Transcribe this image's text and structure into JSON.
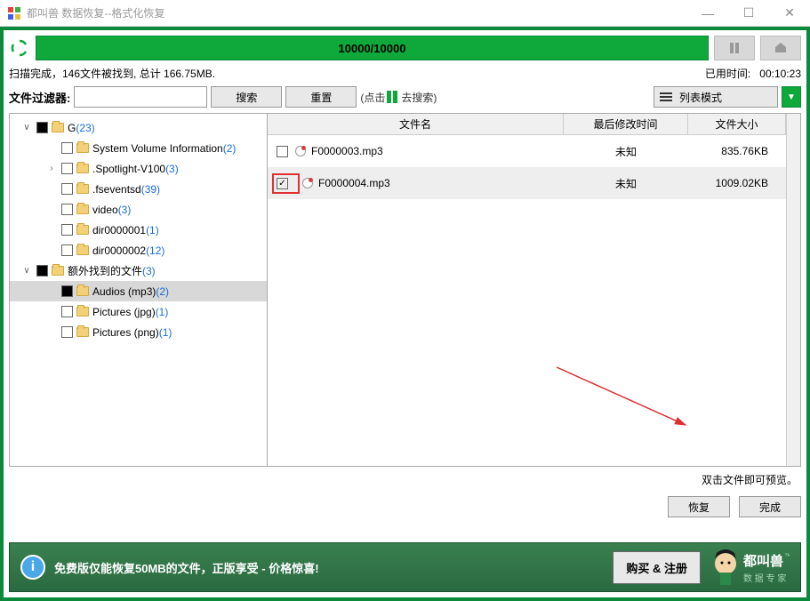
{
  "window": {
    "title": "都叫兽 数据恢复--格式化恢复"
  },
  "progress": {
    "text": "10000/10000"
  },
  "status": {
    "left": "扫描完成，146文件被找到, 总计 166.75MB.",
    "elapsed_label": "已用时间:",
    "elapsed_value": "00:10:23"
  },
  "filter": {
    "label": "文件过滤器:",
    "search_btn": "搜索",
    "reset_btn": "重置",
    "hint_prefix": "(点击",
    "hint_suffix": "去搜索)",
    "view_mode": "列表模式"
  },
  "tree": [
    {
      "indent": 0,
      "toggle": "∨",
      "check": "partial",
      "label": "G",
      "count": "(23)"
    },
    {
      "indent": 1,
      "toggle": "",
      "check": "empty",
      "label": "System Volume Information",
      "count": "(2)"
    },
    {
      "indent": 1,
      "toggle": "›",
      "check": "empty",
      "label": ".Spotlight-V100",
      "count": "(3)"
    },
    {
      "indent": 1,
      "toggle": "",
      "check": "empty",
      "label": ".fseventsd",
      "count": "(39)"
    },
    {
      "indent": 1,
      "toggle": "",
      "check": "empty",
      "label": "video",
      "count": "(3)"
    },
    {
      "indent": 1,
      "toggle": "",
      "check": "empty",
      "label": "dir0000001",
      "count": "(1)"
    },
    {
      "indent": 1,
      "toggle": "",
      "check": "empty",
      "label": "dir0000002",
      "count": "(12)"
    },
    {
      "indent": 0,
      "toggle": "∨",
      "check": "partial",
      "label": "额外找到的文件",
      "count": "(3)"
    },
    {
      "indent": 1,
      "toggle": "",
      "check": "partial",
      "label": "Audios (mp3)",
      "count": "(2)",
      "selected": true
    },
    {
      "indent": 1,
      "toggle": "",
      "check": "empty",
      "label": "Pictures (jpg)",
      "count": "(1)"
    },
    {
      "indent": 1,
      "toggle": "",
      "check": "empty",
      "label": "Pictures (png)",
      "count": "(1)"
    }
  ],
  "list": {
    "headers": {
      "name": "文件名",
      "date": "最后修改时间",
      "size": "文件大小"
    },
    "rows": [
      {
        "checked": false,
        "highlight": false,
        "name": "F0000003.mp3",
        "date": "未知",
        "size": "835.76KB"
      },
      {
        "checked": true,
        "highlight": true,
        "name": "F0000004.mp3",
        "date": "未知",
        "size": "1009.02KB"
      }
    ]
  },
  "preview_hint": "双击文件即可预览。",
  "actions": {
    "recover": "恢复",
    "done": "完成"
  },
  "footer": {
    "text": "免费版仅能恢复50MB的文件，正版享受 - 价格惊喜!",
    "buy": "购买 & 注册",
    "brand": "都叫兽",
    "brand_sub": "数 据 专 家"
  }
}
